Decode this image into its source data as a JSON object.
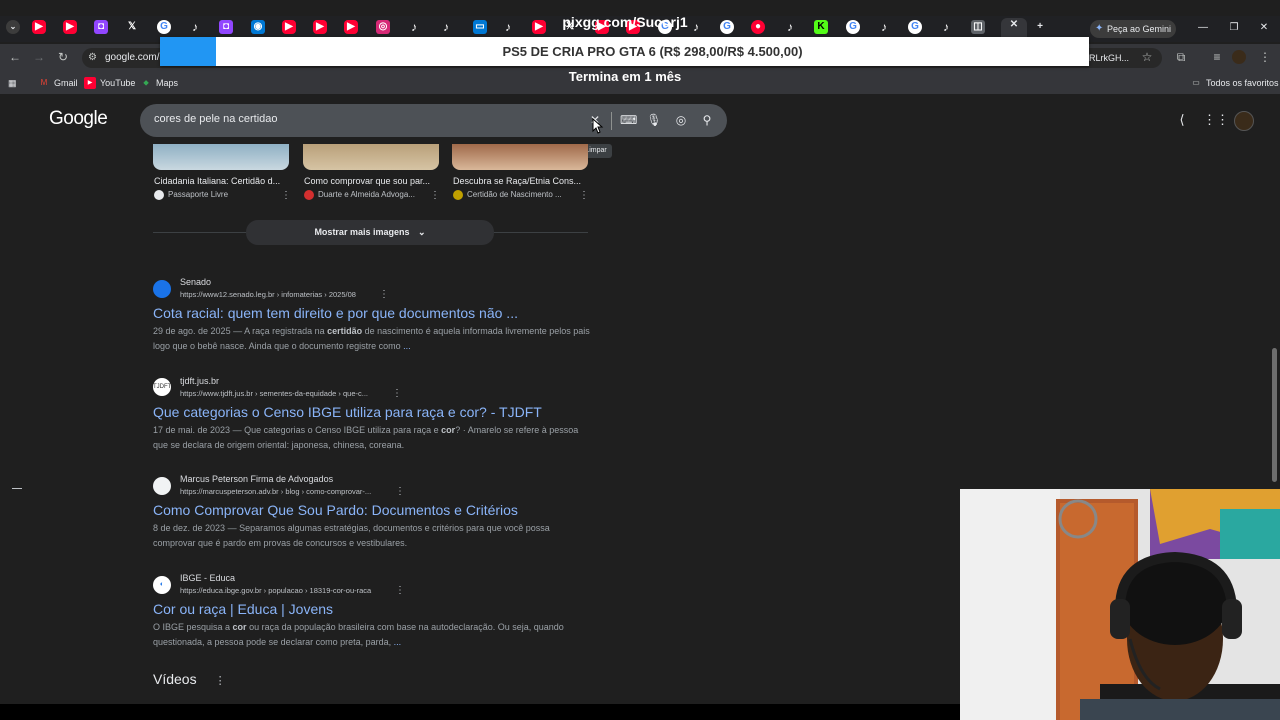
{
  "overlay": {
    "stream_url": "pixgg.com/Sucorj1",
    "banner": "PS5 DE CRIA PRO GTA 6 (R$ 298,00/R$ 4.500,00)",
    "countdown": "Termina em 1 mês"
  },
  "browser": {
    "gemini_button": "Peça ao Gemini",
    "url_visible": "google.com/s",
    "url_tail": "RLrkGH...",
    "bookmarks": [
      {
        "label": "Gmail",
        "icon": "gmail-icon"
      },
      {
        "label": "YouTube",
        "icon": "youtube-icon"
      },
      {
        "label": "Maps",
        "icon": "maps-icon"
      }
    ],
    "all_bookmarks": "Todos os favoritos"
  },
  "google": {
    "logo": "Google",
    "query": "cores de pele na certidao",
    "clear_tooltip": "Limpar"
  },
  "images": [
    {
      "caption": "Cidadania Italiana: Certidão d...",
      "source": "Passaporte Livre"
    },
    {
      "caption": "Como comprovar que sou par...",
      "source": "Duarte e Almeida Advoga..."
    },
    {
      "caption": "Descubra se Raça/Etnia Cons...",
      "source": "Certidão de Nascimento ..."
    }
  ],
  "more_images": "Mostrar mais imagens",
  "results": [
    {
      "site": "Senado",
      "url": "https://www12.senado.leg.br › infomaterias › 2025/08",
      "title": "Cota racial: quem tem direito e por que documentos não ...",
      "date": "29 de ago. de 2025",
      "snippet_a": " — A raça registrada na ",
      "snippet_b": "certidão",
      "snippet_c": " de nascimento é aquela informada livremente pelos pais logo que o bebê nasce. Ainda que o documento registre como ",
      "snippet_ellipsis": "..."
    },
    {
      "site": "tjdft.jus.br",
      "url": "https://www.tjdft.jus.br › sementes-da-equidade › que-c...",
      "title": "Que categorias o Censo IBGE utiliza para raça e cor? - TJDFT",
      "date": "17 de mai. de 2023",
      "snippet_a": " — Que categorias o Censo IBGE utiliza para raça e ",
      "snippet_b": "cor",
      "snippet_c": "? · Amarelo se refere à pessoa que se declara de origem oriental: japonesa, chinesa, coreana.",
      "snippet_ellipsis": ""
    },
    {
      "site": "Marcus Peterson Firma de Advogados",
      "url": "https://marcuspeterson.adv.br › blog › como-comprovar-...",
      "title": "Como Comprovar Que Sou Pardo: Documentos e Critérios",
      "date": "8 de dez. de 2023",
      "snippet_a": " — Separamos algumas estratégias, documentos e critérios para que você possa comprovar que é pardo em provas de concursos e vestibulares.",
      "snippet_b": "",
      "snippet_c": "",
      "snippet_ellipsis": ""
    },
    {
      "site": "IBGE - Educa",
      "url": "https://educa.ibge.gov.br › populacao › 18319-cor-ou-raca",
      "title": "Cor ou raça | Educa | Jovens",
      "date": "",
      "snippet_a": "O IBGE pesquisa a ",
      "snippet_b": "cor",
      "snippet_c": " ou raça da população brasileira com base na autodeclaração. Ou seja, quando questionada, a pessoa pode se declarar como preta, parda, ",
      "snippet_ellipsis": "..."
    }
  ],
  "videos_heading": "Vídeos",
  "colors": {
    "background": "#1f1f1f",
    "link": "#8ab4f8",
    "banner_accent": "#2196f3"
  }
}
